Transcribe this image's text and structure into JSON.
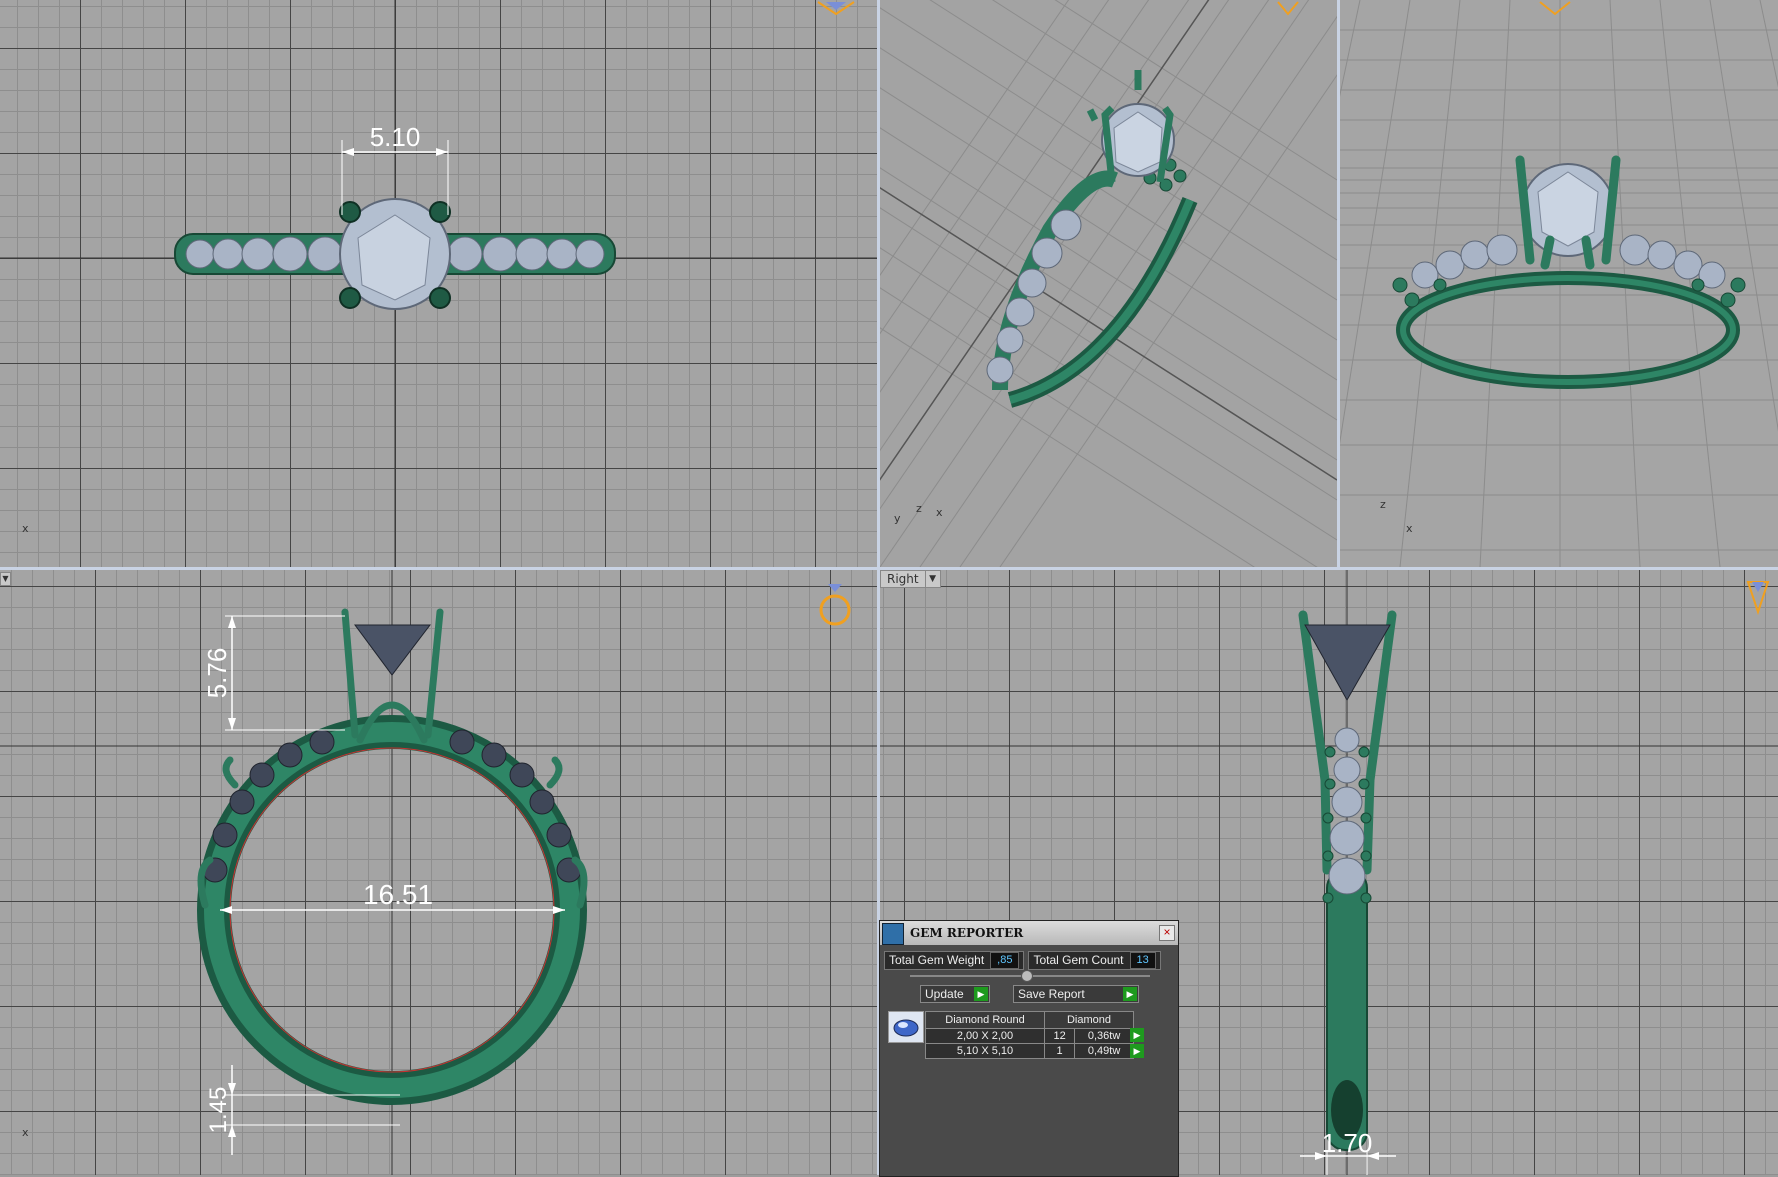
{
  "viewports": {
    "top": {
      "axis_label": "x",
      "dimension": "5.10"
    },
    "perspective": {
      "axis_labels": [
        "y",
        "z",
        "x"
      ]
    },
    "perspective2": {
      "axis_labels": [
        "z",
        "x"
      ]
    },
    "front": {
      "axis_label": "x",
      "dimensions": [
        "5.76",
        "16.51",
        "1.45"
      ]
    },
    "right": {
      "menu_label": "Right",
      "dimension": "1.70"
    }
  },
  "gem_reporter": {
    "title": "GEM REPORTER",
    "close": "×",
    "total_weight_label": "Total Gem Weight",
    "total_weight_value": ",85",
    "total_count_label": "Total Gem Count",
    "total_count_value": "13",
    "update_label": "Update",
    "save_report_label": "Save Report",
    "table": {
      "headers": [
        "Diamond Round",
        "Diamond"
      ],
      "rows": [
        {
          "size": "2,00 X 2,00",
          "count": "12",
          "weight": "0,36tw"
        },
        {
          "size": "5,10 X 5,10",
          "count": "1",
          "weight": "0,49tw"
        }
      ]
    }
  },
  "colors": {
    "metal": "#2c7a5e",
    "gem": "#a9b4c6",
    "grid": "#a4a4a4",
    "accent": "#f0a020"
  }
}
